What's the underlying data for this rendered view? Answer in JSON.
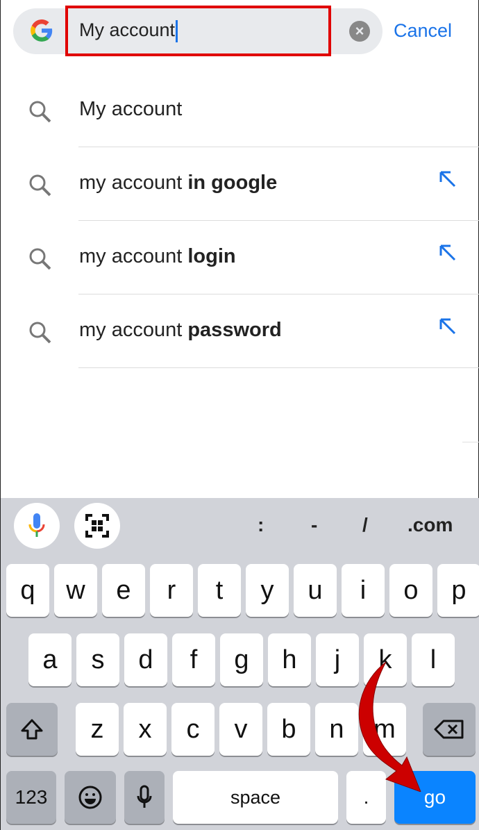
{
  "search": {
    "value": "My account",
    "clear_icon": "clear-icon",
    "cancel_label": "Cancel"
  },
  "suggestions": [
    {
      "prefix": "My account",
      "bold": ""
    },
    {
      "prefix": "my account ",
      "bold": "in google"
    },
    {
      "prefix": "my account ",
      "bold": "login"
    },
    {
      "prefix": "my account ",
      "bold": "password"
    }
  ],
  "keyboard": {
    "symbols": [
      ":",
      "-",
      "/",
      ".com"
    ],
    "row1": [
      "q",
      "w",
      "e",
      "r",
      "t",
      "y",
      "u",
      "i",
      "o",
      "p"
    ],
    "row2": [
      "a",
      "s",
      "d",
      "f",
      "g",
      "h",
      "j",
      "k",
      "l"
    ],
    "row3": [
      "z",
      "x",
      "c",
      "v",
      "b",
      "n",
      "m"
    ],
    "numbers_label": "123",
    "space_label": "space",
    "period_label": ".",
    "go_label": "go"
  },
  "colors": {
    "accent": "#1a73e8",
    "go": "#0a84ff",
    "highlight": "#e00000",
    "arrow": "#cc0000"
  }
}
